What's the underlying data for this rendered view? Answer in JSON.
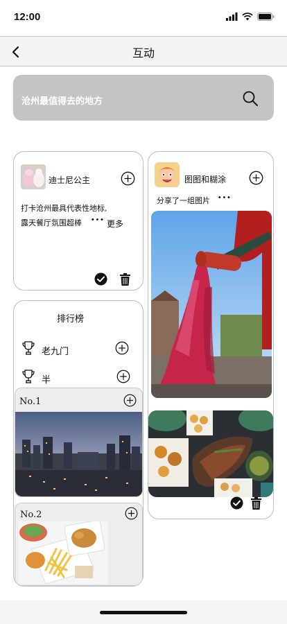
{
  "status": {
    "time": "12:00"
  },
  "nav": {
    "title": "互动"
  },
  "search": {
    "placeholder": "沧州最值得去的地方"
  },
  "post1": {
    "username": "迪士尼公主",
    "text_line1": "打卡沧州最具代表性地标,",
    "text_line2": "露天餐厅氛围超棒",
    "more_label": "更多"
  },
  "post2": {
    "username": "图图和糊涂",
    "caption": "分享了一组图片"
  },
  "ranking": {
    "title": "排行榜",
    "items": [
      {
        "label": "老九门"
      },
      {
        "label": "半"
      }
    ],
    "entries": [
      {
        "label": "No.1"
      },
      {
        "label": "No.2"
      }
    ]
  },
  "icons": {
    "back": "chevron-left-icon",
    "search": "search-icon",
    "plus": "plus-circle-icon",
    "check": "check-circle-icon",
    "trash": "trash-icon",
    "trophy": "trophy-icon"
  }
}
